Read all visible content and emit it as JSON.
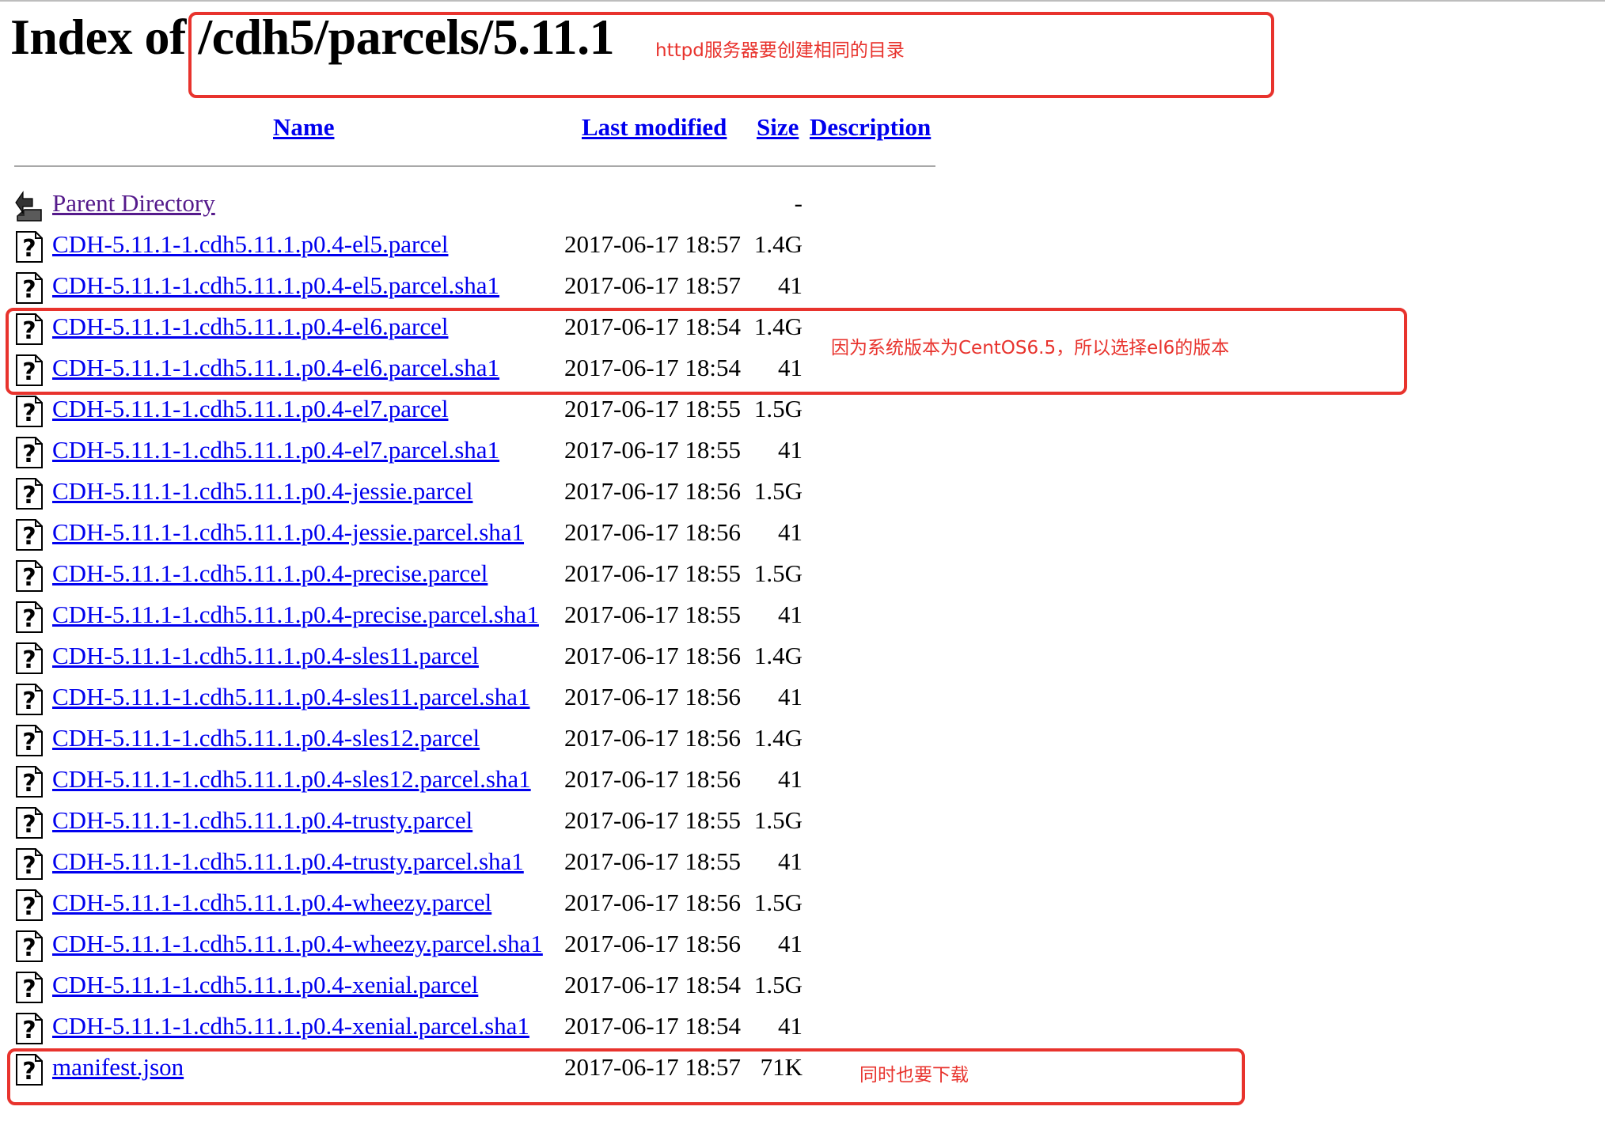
{
  "page": {
    "title_prefix": "Index of ",
    "title_path": "/cdh5/parcels/5.11.1"
  },
  "columns": {
    "name": "Name",
    "last_modified": "Last modified",
    "size": "Size",
    "description": "Description"
  },
  "parent": {
    "label": "Parent Directory",
    "size": "-",
    "icon": "back-folder-icon"
  },
  "rows": [
    {
      "name": "CDH-5.11.1-1.cdh5.11.1.p0.4-el5.parcel",
      "date": "2017-06-17 18:57",
      "size": "1.4G"
    },
    {
      "name": "CDH-5.11.1-1.cdh5.11.1.p0.4-el5.parcel.sha1",
      "date": "2017-06-17 18:57",
      "size": "41"
    },
    {
      "name": "CDH-5.11.1-1.cdh5.11.1.p0.4-el6.parcel",
      "date": "2017-06-17 18:54",
      "size": "1.4G"
    },
    {
      "name": "CDH-5.11.1-1.cdh5.11.1.p0.4-el6.parcel.sha1",
      "date": "2017-06-17 18:54",
      "size": "41"
    },
    {
      "name": "CDH-5.11.1-1.cdh5.11.1.p0.4-el7.parcel",
      "date": "2017-06-17 18:55",
      "size": "1.5G"
    },
    {
      "name": "CDH-5.11.1-1.cdh5.11.1.p0.4-el7.parcel.sha1",
      "date": "2017-06-17 18:55",
      "size": "41"
    },
    {
      "name": "CDH-5.11.1-1.cdh5.11.1.p0.4-jessie.parcel",
      "date": "2017-06-17 18:56",
      "size": "1.5G"
    },
    {
      "name": "CDH-5.11.1-1.cdh5.11.1.p0.4-jessie.parcel.sha1",
      "date": "2017-06-17 18:56",
      "size": "41"
    },
    {
      "name": "CDH-5.11.1-1.cdh5.11.1.p0.4-precise.parcel",
      "date": "2017-06-17 18:55",
      "size": "1.5G"
    },
    {
      "name": "CDH-5.11.1-1.cdh5.11.1.p0.4-precise.parcel.sha1",
      "date": "2017-06-17 18:55",
      "size": "41"
    },
    {
      "name": "CDH-5.11.1-1.cdh5.11.1.p0.4-sles11.parcel",
      "date": "2017-06-17 18:56",
      "size": "1.4G"
    },
    {
      "name": "CDH-5.11.1-1.cdh5.11.1.p0.4-sles11.parcel.sha1",
      "date": "2017-06-17 18:56",
      "size": "41"
    },
    {
      "name": "CDH-5.11.1-1.cdh5.11.1.p0.4-sles12.parcel",
      "date": "2017-06-17 18:56",
      "size": "1.4G"
    },
    {
      "name": "CDH-5.11.1-1.cdh5.11.1.p0.4-sles12.parcel.sha1",
      "date": "2017-06-17 18:56",
      "size": "41"
    },
    {
      "name": "CDH-5.11.1-1.cdh5.11.1.p0.4-trusty.parcel",
      "date": "2017-06-17 18:55",
      "size": "1.5G"
    },
    {
      "name": "CDH-5.11.1-1.cdh5.11.1.p0.4-trusty.parcel.sha1",
      "date": "2017-06-17 18:55",
      "size": "41"
    },
    {
      "name": "CDH-5.11.1-1.cdh5.11.1.p0.4-wheezy.parcel",
      "date": "2017-06-17 18:56",
      "size": "1.5G"
    },
    {
      "name": "CDH-5.11.1-1.cdh5.11.1.p0.4-wheezy.parcel.sha1",
      "date": "2017-06-17 18:56",
      "size": "41"
    },
    {
      "name": "CDH-5.11.1-1.cdh5.11.1.p0.4-xenial.parcel",
      "date": "2017-06-17 18:54",
      "size": "1.5G"
    },
    {
      "name": "CDH-5.11.1-1.cdh5.11.1.p0.4-xenial.parcel.sha1",
      "date": "2017-06-17 18:54",
      "size": "41"
    },
    {
      "name": "manifest.json",
      "date": "2017-06-17 18:57",
      "size": "71K"
    }
  ],
  "annotations": {
    "title_note": "httpd服务器要创建相同的目录",
    "el6_note": "因为系统版本为CentOS6.5，所以选择el6的版本",
    "manifest_note": "同时也要下载",
    "color": "#e8332d"
  },
  "file_icon": "unknown-file-icon"
}
